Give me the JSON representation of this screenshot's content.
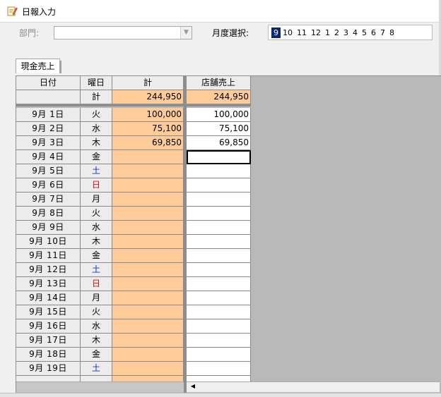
{
  "window": {
    "title": "日報入力",
    "icon": "edit-note-icon"
  },
  "toolbar": {
    "dept_label": "部門:",
    "dept_value": "",
    "month_label": "月度選択:",
    "months": [
      "9",
      "10",
      "11",
      "12",
      "1",
      "2",
      "3",
      "4",
      "5",
      "6",
      "7",
      "8"
    ],
    "selected_month": "9"
  },
  "tabs": [
    {
      "label": "現金売上"
    }
  ],
  "grid": {
    "headers": {
      "date": "日付",
      "weekday": "曜日",
      "total": "計",
      "store": "店舗売上"
    },
    "summary": {
      "label": "計",
      "total": "244,950",
      "store": "244,950"
    },
    "rows": [
      {
        "date": "9月 1日",
        "weekday": "火",
        "total": "100,000",
        "store": "100,000"
      },
      {
        "date": "9月 2日",
        "weekday": "水",
        "total": "75,100",
        "store": "75,100"
      },
      {
        "date": "9月 3日",
        "weekday": "木",
        "total": "69,850",
        "store": "69,850"
      },
      {
        "date": "9月 4日",
        "weekday": "金",
        "total": "",
        "store": ""
      },
      {
        "date": "9月 5日",
        "weekday": "土",
        "total": "",
        "store": ""
      },
      {
        "date": "9月 6日",
        "weekday": "日",
        "total": "",
        "store": ""
      },
      {
        "date": "9月 7日",
        "weekday": "月",
        "total": "",
        "store": ""
      },
      {
        "date": "9月 8日",
        "weekday": "火",
        "total": "",
        "store": ""
      },
      {
        "date": "9月 9日",
        "weekday": "水",
        "total": "",
        "store": ""
      },
      {
        "date": "9月 10日",
        "weekday": "木",
        "total": "",
        "store": ""
      },
      {
        "date": "9月 11日",
        "weekday": "金",
        "total": "",
        "store": ""
      },
      {
        "date": "9月 12日",
        "weekday": "土",
        "total": "",
        "store": ""
      },
      {
        "date": "9月 13日",
        "weekday": "日",
        "total": "",
        "store": ""
      },
      {
        "date": "9月 14日",
        "weekday": "月",
        "total": "",
        "store": ""
      },
      {
        "date": "9月 15日",
        "weekday": "火",
        "total": "",
        "store": ""
      },
      {
        "date": "9月 16日",
        "weekday": "水",
        "total": "",
        "store": ""
      },
      {
        "date": "9月 17日",
        "weekday": "木",
        "total": "",
        "store": ""
      },
      {
        "date": "9月 18日",
        "weekday": "金",
        "total": "",
        "store": ""
      },
      {
        "date": "9月 19日",
        "weekday": "土",
        "total": "",
        "store": ""
      }
    ]
  },
  "colors": {
    "total_fill": "#ffcc99",
    "saturday": "#1a33c8",
    "sunday": "#d01010",
    "selected_month_bg": "#0b2a6e"
  }
}
